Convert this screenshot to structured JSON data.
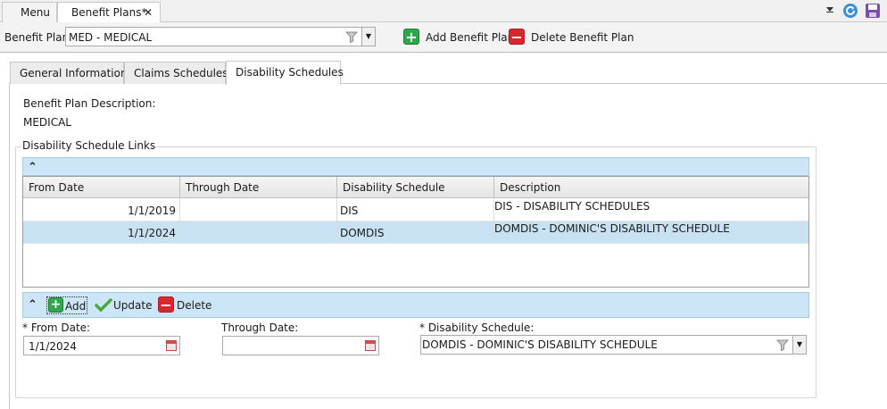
{
  "doc_tabs": [
    {
      "label": "Menu"
    },
    {
      "label": "Benefit Plans*",
      "close": "✕"
    }
  ],
  "toolbar": {
    "benefit_plan_label": "Benefit Plan:",
    "benefit_plan_value": "MED - MEDICAL",
    "add_label": "Add Benefit Plan",
    "delete_label": "Delete Benefit Plan"
  },
  "section_tabs": [
    {
      "label": "General Information"
    },
    {
      "label": "Claims Schedules"
    },
    {
      "label": "Disability Schedules"
    }
  ],
  "details": {
    "description_label": "Benefit Plan Description:",
    "description_value": "MEDICAL"
  },
  "links": {
    "group_label": "Disability Schedule Links",
    "collapse_glyph": "⌃",
    "columns": [
      "From Date",
      "Through Date",
      "Disability Schedule",
      "Description"
    ],
    "rows": [
      {
        "from": "1/1/2019",
        "through": "",
        "schedule": "DIS",
        "description": "DIS - DISABILITY SCHEDULES"
      },
      {
        "from": "1/1/2024",
        "through": "",
        "schedule": "DOMDIS",
        "description": "DOMDIS - DOMINIC'S DISABILITY SCHEDULE"
      }
    ],
    "actions": {
      "add_label": "Add",
      "update_label": "Update",
      "delete_label": "Delete"
    }
  },
  "form": {
    "from_label": "* From Date:",
    "from_value": "1/1/2024",
    "through_label": "Through Date:",
    "through_value": "",
    "schedule_label": "* Disability Schedule:",
    "schedule_value": "DOMDIS - DOMINIC'S DISABILITY SCHEDULE"
  },
  "icons": {
    "add": "plus-icon",
    "delete": "minus-icon",
    "update": "checkmark-icon",
    "refresh": "refresh-icon",
    "save": "save-icon",
    "filter": "filter-icon",
    "calendar": "calendar-icon"
  },
  "colors": {
    "selected_row": "#c8e2f3",
    "header_bar": "#cde6f7",
    "green_button": "#2ea84a",
    "red_button": "#d9272e"
  }
}
